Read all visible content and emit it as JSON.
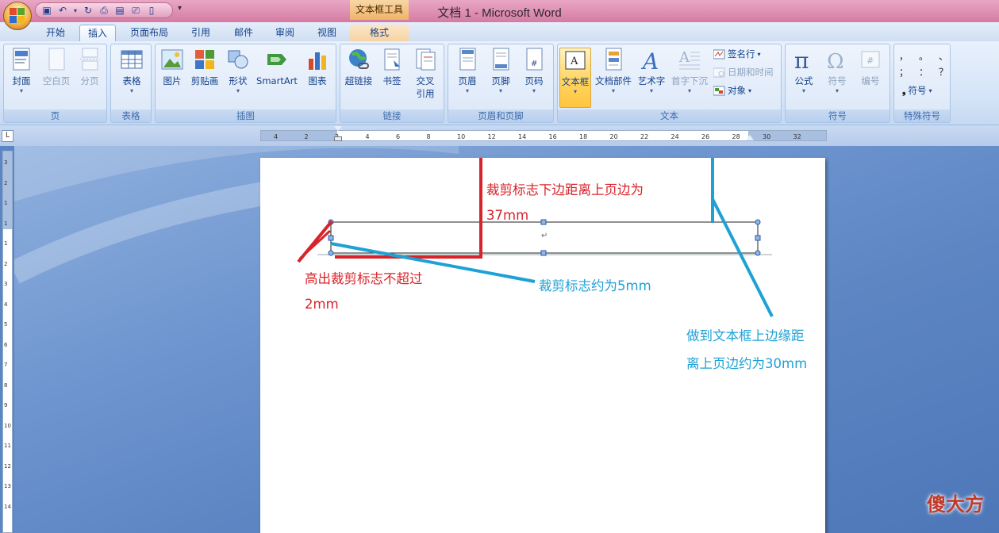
{
  "window": {
    "title": "文档 1 - Microsoft Word",
    "context_tool_title": "文本框工具"
  },
  "tabs": [
    {
      "label": "开始"
    },
    {
      "label": "插入",
      "active": true
    },
    {
      "label": "页面布局"
    },
    {
      "label": "引用"
    },
    {
      "label": "邮件"
    },
    {
      "label": "审阅"
    },
    {
      "label": "视图"
    },
    {
      "label": "格式",
      "contextual": true
    }
  ],
  "ribbon": {
    "groups": {
      "page": {
        "label": "页",
        "buttons": [
          {
            "label": "封面",
            "icon": "cover-page-icon"
          },
          {
            "label": "空白页",
            "icon": "blank-page-icon",
            "disabled": true
          },
          {
            "label": "分页",
            "icon": "page-break-icon",
            "disabled": true
          }
        ]
      },
      "table": {
        "label": "表格",
        "buttons": [
          {
            "label": "表格",
            "icon": "table-icon"
          }
        ]
      },
      "illustrations": {
        "label": "插图",
        "buttons": [
          {
            "label": "图片",
            "icon": "picture-icon"
          },
          {
            "label": "剪贴画",
            "icon": "clipart-icon"
          },
          {
            "label": "形状",
            "icon": "shapes-icon"
          },
          {
            "label": "SmartArt",
            "icon": "smartart-icon"
          },
          {
            "label": "图表",
            "icon": "chart-icon"
          }
        ]
      },
      "links": {
        "label": "链接",
        "buttons": [
          {
            "label": "超链接",
            "icon": "hyperlink-icon"
          },
          {
            "label": "书签",
            "icon": "bookmark-icon"
          },
          {
            "label": "交叉\n引用",
            "line1": "交叉",
            "line2": "引用",
            "icon": "cross-reference-icon"
          }
        ]
      },
      "header_footer": {
        "label": "页眉和页脚",
        "buttons": [
          {
            "label": "页眉",
            "icon": "header-icon"
          },
          {
            "label": "页脚",
            "icon": "footer-icon"
          },
          {
            "label": "页码",
            "icon": "page-number-icon"
          }
        ]
      },
      "text": {
        "label": "文本",
        "buttons": [
          {
            "label": "文本框",
            "icon": "textbox-icon",
            "selected": true
          },
          {
            "label": "文档部件",
            "icon": "quick-parts-icon"
          },
          {
            "label": "艺术字",
            "icon": "wordart-icon"
          },
          {
            "label": "首字下沉",
            "icon": "drop-cap-icon",
            "disabled": true
          }
        ],
        "small": [
          {
            "label": "签名行",
            "icon": "signature-line-icon"
          },
          {
            "label": "日期和时间",
            "icon": "date-time-icon",
            "disabled": true
          },
          {
            "label": "对象",
            "icon": "object-icon"
          }
        ]
      },
      "symbols": {
        "label": "符号",
        "buttons": [
          {
            "label": "公式",
            "icon": "pi-icon"
          },
          {
            "label": "符号",
            "icon": "omega-icon",
            "disabled": true
          },
          {
            "label": "编号",
            "icon": "number-icon",
            "disabled": true
          }
        ]
      },
      "special": {
        "label": "特殊符号",
        "chars_row1": [
          "，",
          "。",
          "、"
        ],
        "chars_row2": [
          "；",
          "：",
          "？"
        ],
        "symbol_button": "符号"
      }
    }
  },
  "ruler": {
    "h_ticks": [
      "4",
      "2",
      "2",
      "4",
      "6",
      "8",
      "10",
      "12",
      "14",
      "16",
      "18",
      "20",
      "22",
      "24",
      "26",
      "28",
      "30",
      "32"
    ],
    "v_ticks": [
      "3",
      "2",
      "1",
      "1",
      "1",
      "2",
      "3",
      "4",
      "5",
      "6",
      "7",
      "8",
      "9",
      "10",
      "11",
      "12",
      "13",
      "14"
    ]
  },
  "annotations": {
    "red_top_line1": "裁剪标志下边距离上页边为",
    "red_top_line2": "37mm",
    "red_bottom_line1": "高出裁剪标志不超过",
    "red_bottom_line2": "2mm",
    "blue_mid": "裁剪标志约为5mm",
    "blue_right_line1": "做到文本框上边缘距",
    "blue_right_line2": "离上页边约为30mm",
    "paragraph_mark": "↵"
  },
  "colors": {
    "annotation_red": "#d8232a",
    "annotation_blue": "#1fa1d6",
    "ribbon_accent": "#15428b"
  },
  "watermark": "傻大方"
}
